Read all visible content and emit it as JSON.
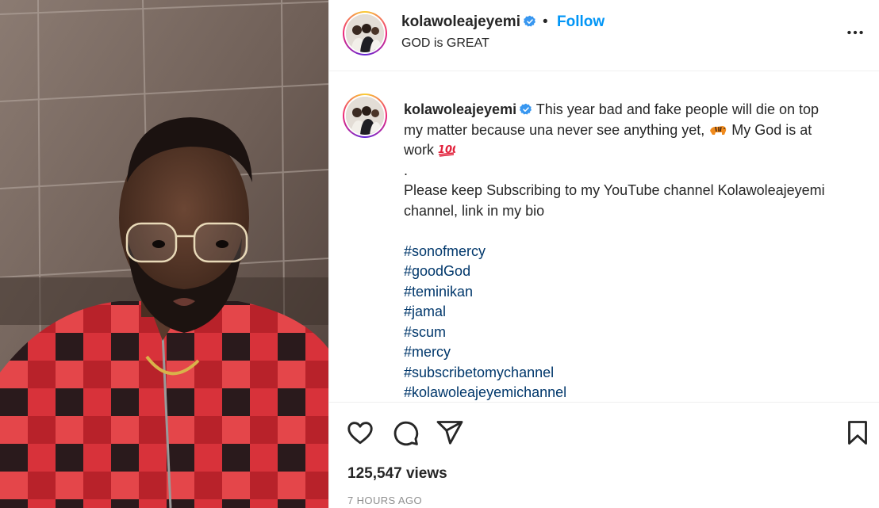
{
  "post": {
    "username": "kolawoleajeyemi",
    "verified": true,
    "follow_label": "Follow",
    "separator": "•",
    "subtitle": "GOD is GREAT",
    "caption_lines": [
      "This year bad and fake people will die on top",
      "my matter because una never see anything yet,",
      "My God is at",
      "work",
      ".",
      "Please keep Subscribing to my YouTube channel Kolawoleajeyemi",
      "channel, link in my bio"
    ],
    "hashtags": [
      "#sonofmercy",
      "#goodGod",
      "#teminikan",
      "#jamal",
      "#scum",
      "#mercy",
      "#subscribetomychannel",
      "#kolawoleajeyemichannel"
    ],
    "views_count": "125,547 views",
    "timestamp": "7 HOURS AGO"
  },
  "icons": {
    "verified": "verified-badge-icon",
    "more": "more-options-icon",
    "like": "heart-icon",
    "comment": "comment-icon",
    "share": "share-icon",
    "save": "bookmark-icon",
    "emoji_1": "tiger-emoji",
    "emoji_2": "hundred-points-emoji"
  },
  "colors": {
    "link_blue": "#0095f6",
    "hashtag": "#00376b",
    "text": "#262626",
    "muted": "#8e8e8e",
    "verified": "#3897f0"
  }
}
